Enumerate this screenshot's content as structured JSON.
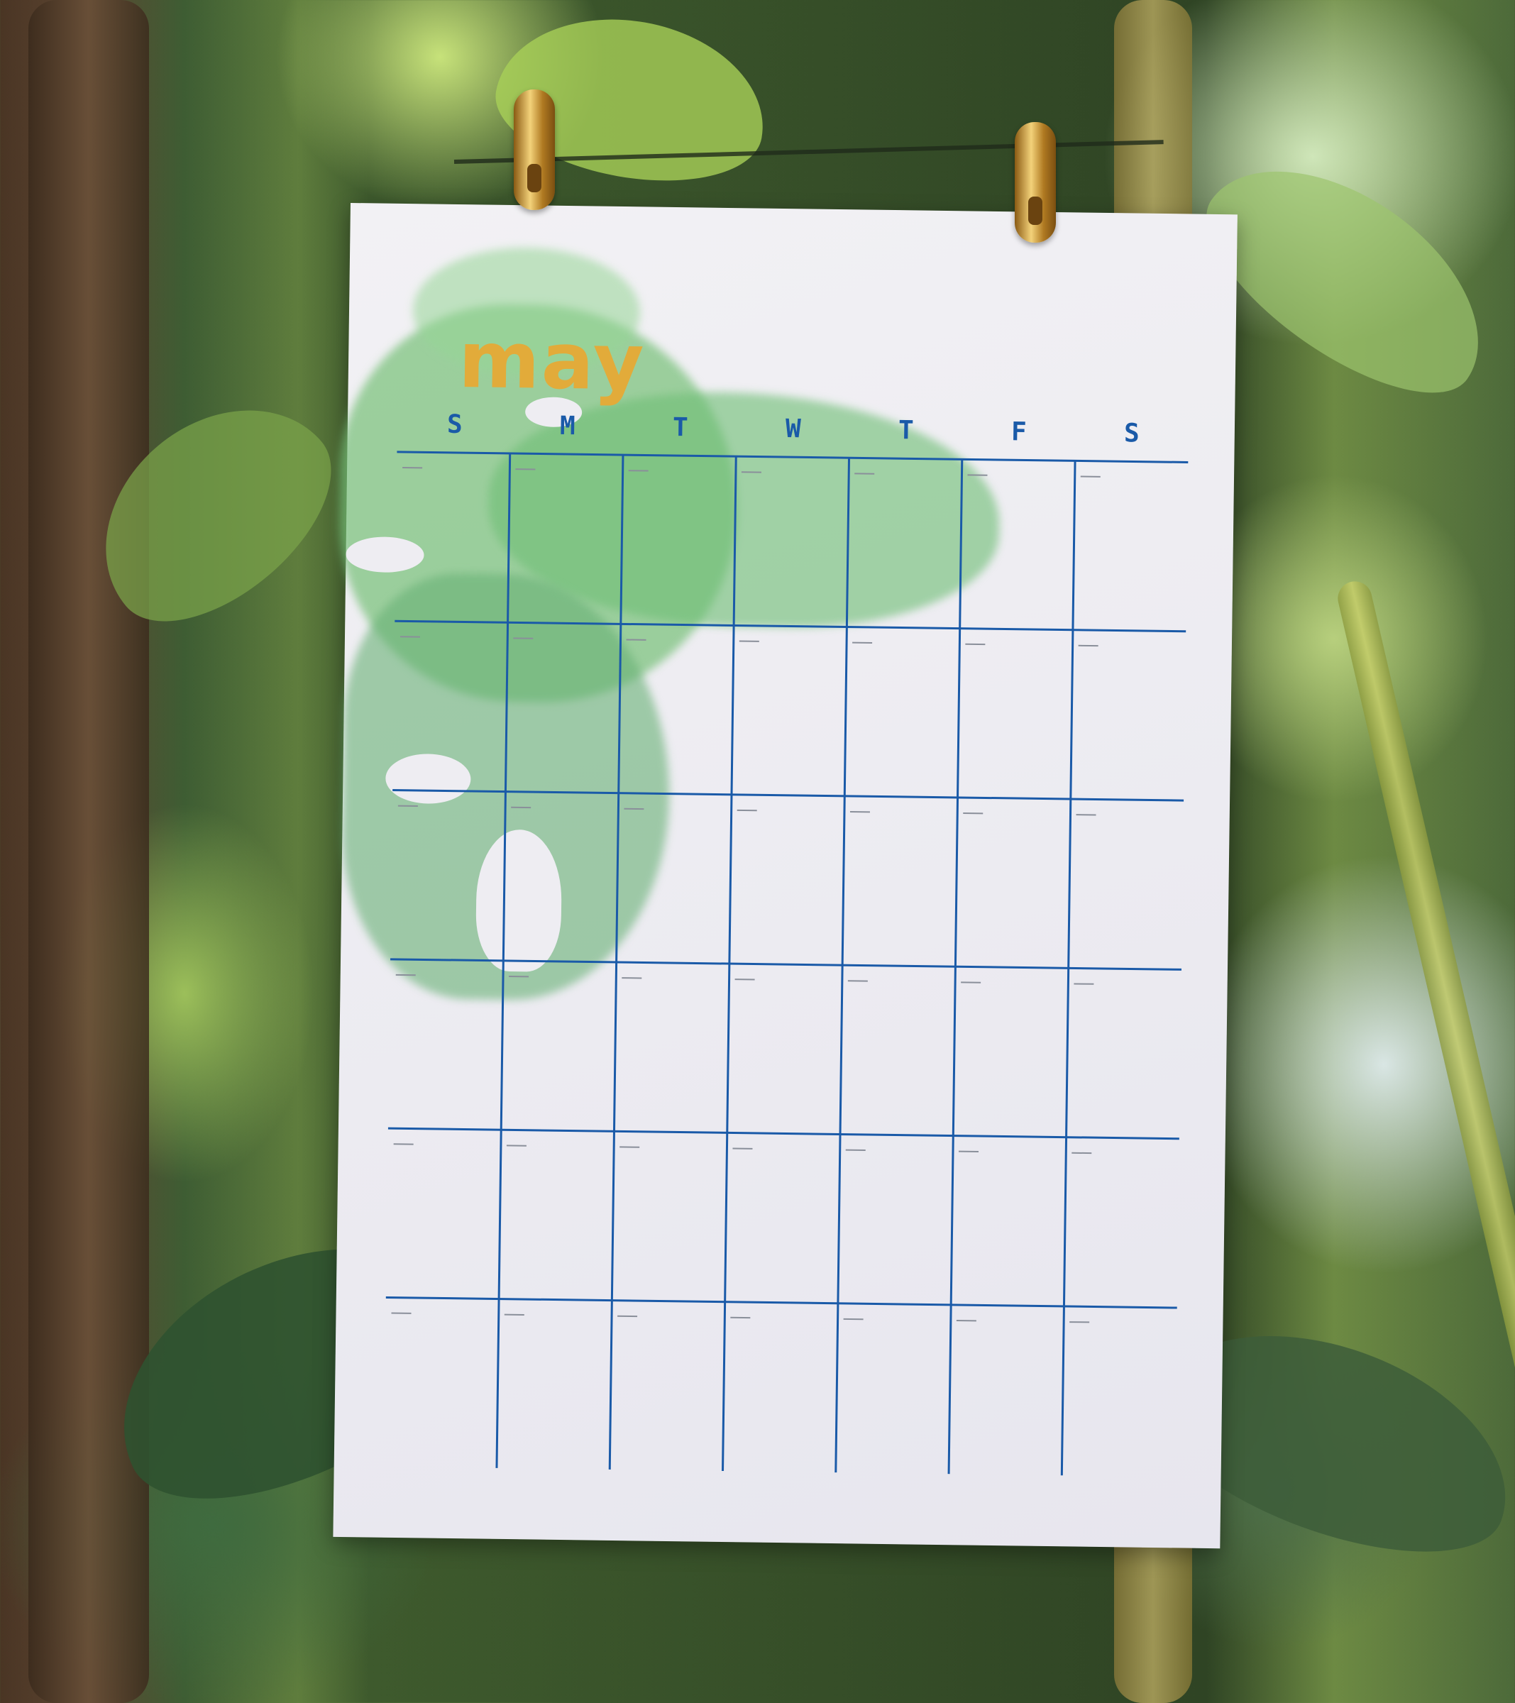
{
  "calendar": {
    "month": "may",
    "weekdays": [
      "S",
      "M",
      "T",
      "W",
      "T",
      "F",
      "S"
    ],
    "rows": 6,
    "columns": 7
  },
  "colors": {
    "month_text": "#e2ab3a",
    "grid_lines": "#1a5aa8",
    "watercolor": "#76c078",
    "paper": "#eeedf2",
    "clips": "#d4a545"
  },
  "scene": {
    "background": "blurred tropical foliage",
    "clip_icons": [
      "gold-binder-clip-icon",
      "gold-binder-clip-icon"
    ]
  }
}
